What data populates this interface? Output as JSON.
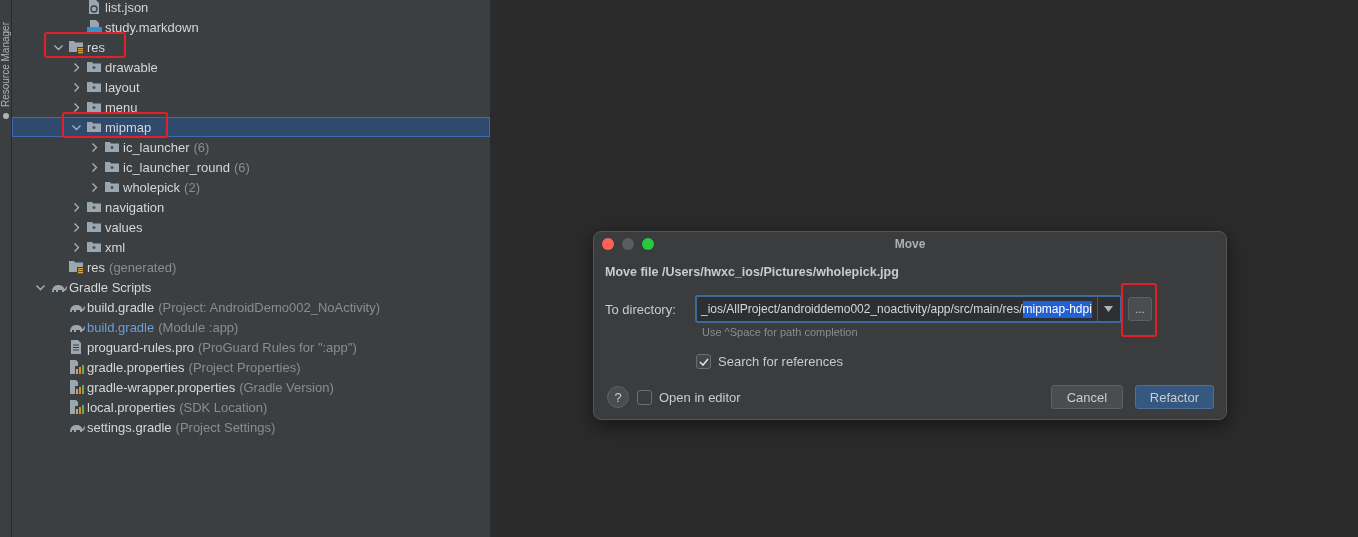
{
  "side_tab": {
    "label": "Resource Manager"
  },
  "tree": [
    {
      "children": [
        {
          "children": [
            {
              "label": "list.json",
              "kind": "json",
              "selected": false,
              "highlighted": false,
              "modified": false
            },
            {
              "label": "study.markdown",
              "kind": "markdown",
              "selected": false,
              "highlighted": false,
              "modified": false
            }
          ]
        },
        {
          "label": "res",
          "kind": "res-folder",
          "expanded": true,
          "selected": false,
          "highlighted": true,
          "children": [
            {
              "label": "drawable",
              "kind": "folder",
              "expanded": false,
              "selected": false,
              "highlighted": false
            },
            {
              "label": "layout",
              "kind": "folder",
              "expanded": false,
              "selected": false,
              "highlighted": false
            },
            {
              "label": "menu",
              "kind": "folder",
              "expanded": false,
              "selected": false,
              "highlighted": false
            },
            {
              "label": "mipmap",
              "kind": "folder",
              "expanded": true,
              "selected": true,
              "highlighted": true,
              "children": [
                {
                  "label": "ic_launcher",
                  "note": "(6)",
                  "kind": "folder",
                  "expanded": false,
                  "selected": false,
                  "highlighted": false
                },
                {
                  "label": "ic_launcher_round",
                  "note": "(6)",
                  "kind": "folder",
                  "expanded": false,
                  "selected": false,
                  "highlighted": false
                },
                {
                  "label": "wholepick",
                  "note": "(2)",
                  "kind": "folder",
                  "expanded": false,
                  "selected": false,
                  "highlighted": false
                }
              ]
            },
            {
              "label": "navigation",
              "kind": "folder",
              "expanded": false,
              "selected": false,
              "highlighted": false
            },
            {
              "label": "values",
              "kind": "folder",
              "expanded": false,
              "selected": false,
              "highlighted": false
            },
            {
              "label": "xml",
              "kind": "folder",
              "expanded": false,
              "selected": false,
              "highlighted": false
            }
          ]
        },
        {
          "label": "res",
          "note": "(generated)",
          "kind": "res-folder",
          "selected": false,
          "highlighted": false,
          "modified": false
        }
      ]
    },
    {
      "label": "Gradle Scripts",
      "kind": "gradle",
      "expanded": true,
      "selected": false,
      "highlighted": false,
      "children": [
        {
          "label": "build.gradle",
          "note": "(Project: AndroidDemo002_NoActivity)",
          "kind": "gradle",
          "selected": false,
          "highlighted": false,
          "modified": false
        },
        {
          "label": "build.gradle",
          "note": "(Module :app)",
          "kind": "gradle",
          "selected": false,
          "highlighted": false,
          "modified": true
        },
        {
          "label": "proguard-rules.pro",
          "note": "(ProGuard Rules for \":app\")",
          "kind": "text",
          "selected": false,
          "highlighted": false,
          "modified": false
        },
        {
          "label": "gradle.properties",
          "note": "(Project Properties)",
          "kind": "properties",
          "selected": false,
          "highlighted": false,
          "modified": false
        },
        {
          "label": "gradle-wrapper.properties",
          "note": "(Gradle Version)",
          "kind": "properties",
          "selected": false,
          "highlighted": false,
          "modified": false
        },
        {
          "label": "local.properties",
          "note": "(SDK Location)",
          "kind": "properties",
          "selected": false,
          "highlighted": false,
          "modified": false
        },
        {
          "label": "settings.gradle",
          "note": "(Project Settings)",
          "kind": "gradle",
          "selected": false,
          "highlighted": false,
          "modified": false
        }
      ]
    }
  ],
  "dialog": {
    "title": "Move",
    "heading": "Move file /Users/hwxc_ios/Pictures/wholepick.jpg",
    "directory": {
      "label": "To directory:",
      "value_before_selection": "_ios/AllProject/androiddemo002_noactivity/app/src/main/res/",
      "selected_text": "mipmap-hdpi",
      "hint": "Use ^Space for path completion",
      "browse": {
        "label": "...",
        "highlighted": true
      }
    },
    "search_references": {
      "label": "Search for references",
      "checked": true
    },
    "open_in_editor": {
      "label": "Open in editor",
      "checked": false
    },
    "help": {
      "label": "?"
    },
    "buttons": [
      {
        "label": "Cancel",
        "kind": "secondary"
      },
      {
        "label": "Refactor",
        "kind": "primary"
      }
    ]
  }
}
